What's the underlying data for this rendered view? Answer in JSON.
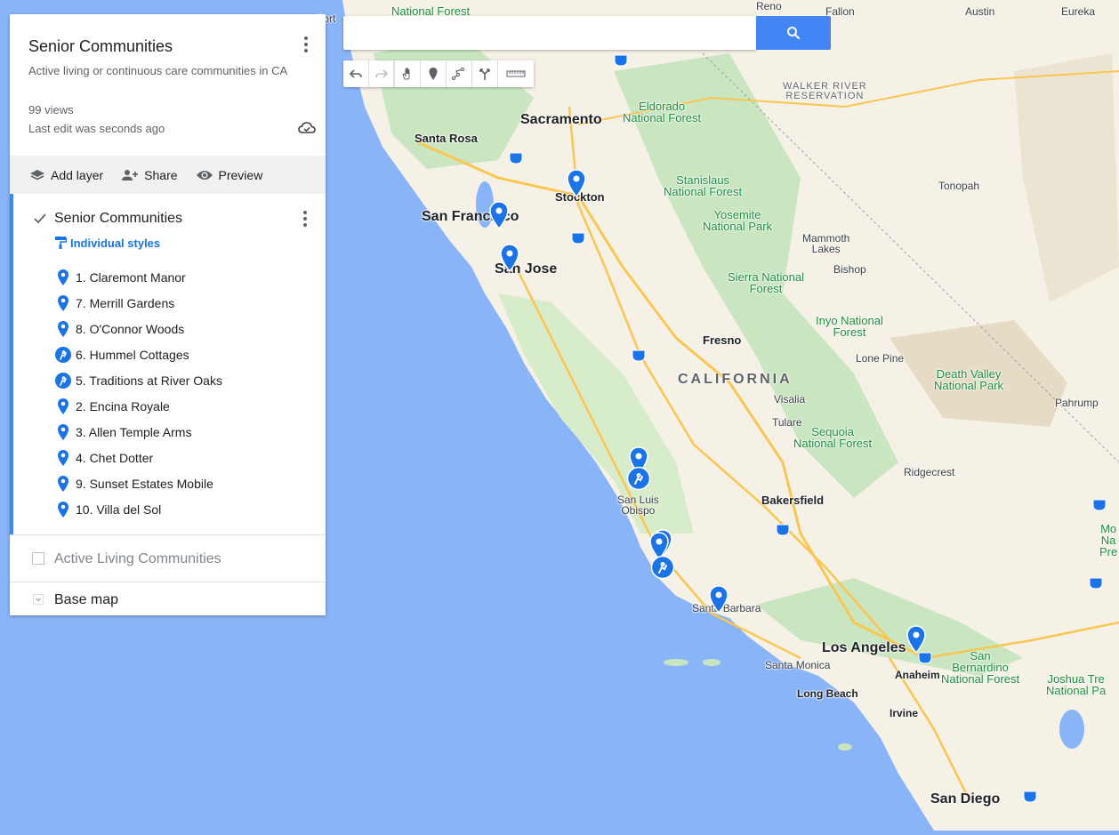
{
  "colors": {
    "water": "#8ab4f8",
    "land": "#f5f1e6",
    "green": "#c9e6c1",
    "accent": "#4285f4",
    "pin": "#1a73e8"
  },
  "search": {
    "placeholder": ""
  },
  "toolbar": {
    "tools": [
      "undo-icon",
      "redo-icon",
      "hand-icon",
      "marker-icon",
      "draw-line-icon",
      "directions-icon",
      "ruler-icon"
    ]
  },
  "panel": {
    "title": "Senior Communities",
    "description": "Active living or continuous care communities in CA",
    "views": "99 views",
    "last_edit": "Last edit was seconds ago",
    "actions": {
      "add_layer": "Add layer",
      "share": "Share",
      "preview": "Preview"
    },
    "layer1": {
      "title": "Senior Communities",
      "style_label": "Individual styles",
      "items": [
        {
          "label": "1. Claremont Manor",
          "icon": "pin-icon"
        },
        {
          "label": "7. Merrill Gardens",
          "icon": "pin-icon"
        },
        {
          "label": "8. O'Connor Woods",
          "icon": "pin-icon"
        },
        {
          "label": "6. Hummel Cottages",
          "icon": "activity-icon"
        },
        {
          "label": "5. Traditions at River Oaks",
          "icon": "activity-icon"
        },
        {
          "label": "2. Encina Royale",
          "icon": "pin-icon"
        },
        {
          "label": "3. Allen Temple Arms",
          "icon": "pin-icon"
        },
        {
          "label": "4. Chet Dotter",
          "icon": "pin-icon"
        },
        {
          "label": "9. Sunset Estates Mobile",
          "icon": "pin-icon"
        },
        {
          "label": "10. Villa del Sol",
          "icon": "pin-icon"
        }
      ]
    },
    "layer2": {
      "title": "Active Living Communities"
    },
    "basemap": {
      "title": "Base map"
    }
  },
  "map": {
    "labels": {
      "sacramento": "Sacramento",
      "santa_rosa": "Santa Rosa",
      "stockton": "Stockton",
      "san_francisco": "San Francisco",
      "san_jose": "San Jose",
      "fresno": "Fresno",
      "california": "CALIFORNIA",
      "visalia": "Visalia",
      "tulare": "Tulare",
      "bakersfield": "Bakersfield",
      "san_luis_obispo": "San Luis\nObispo",
      "santa_barbara": "Santa Barbara",
      "los_angeles": "Los Angeles",
      "santa_monica": "Santa Monica",
      "anaheim": "Anaheim",
      "long_beach": "Long Beach",
      "irvine": "Irvine",
      "san_diego": "San Diego",
      "reno": "Reno",
      "fallon": "Fallon",
      "austin": "Austin",
      "eureka": "Eureka",
      "tonopah": "Tonopah",
      "mammoth_lakes": "Mammoth\nLakes",
      "bishop": "Bishop",
      "lone_pine": "Lone Pine",
      "ridgecrest": "Ridgecrest",
      "pahrump": "Pahrump",
      "eldorado": "Eldorado\nNational Forest",
      "stanislaus": "Stanislaus\nNational Forest",
      "yosemite": "Yosemite\nNational Park",
      "sierra": "Sierra National\nForest",
      "inyo": "Inyo National\nForest",
      "sequoia": "Sequoia\nNational Forest",
      "death_valley": "Death Valley\nNational Park",
      "sb_forest": "San\nBernardino\nNational Forest",
      "joshua": "Joshua Tre\nNational Pa",
      "walker": "WALKER RIVER\nRESERVATION",
      "mojave": "Mo\nNa\nPre",
      "nf_top": "National Forest",
      "fort": "Fort"
    }
  }
}
